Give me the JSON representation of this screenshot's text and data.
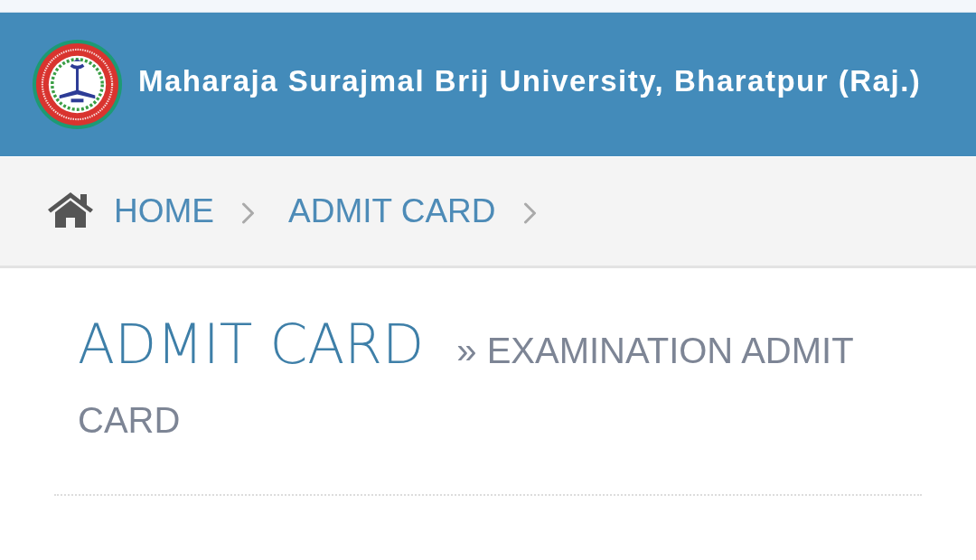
{
  "header": {
    "title": "Maharaja Surajmal Brij University, Bharatpur (Raj.)"
  },
  "breadcrumb": [
    {
      "kind": "home",
      "label": "HOME"
    },
    {
      "kind": "page",
      "label": "ADMIT CARD"
    }
  ],
  "page_heading": {
    "title": "ADMIT CARD",
    "subtitle": "» EXAMINATION ADMIT CARD"
  }
}
